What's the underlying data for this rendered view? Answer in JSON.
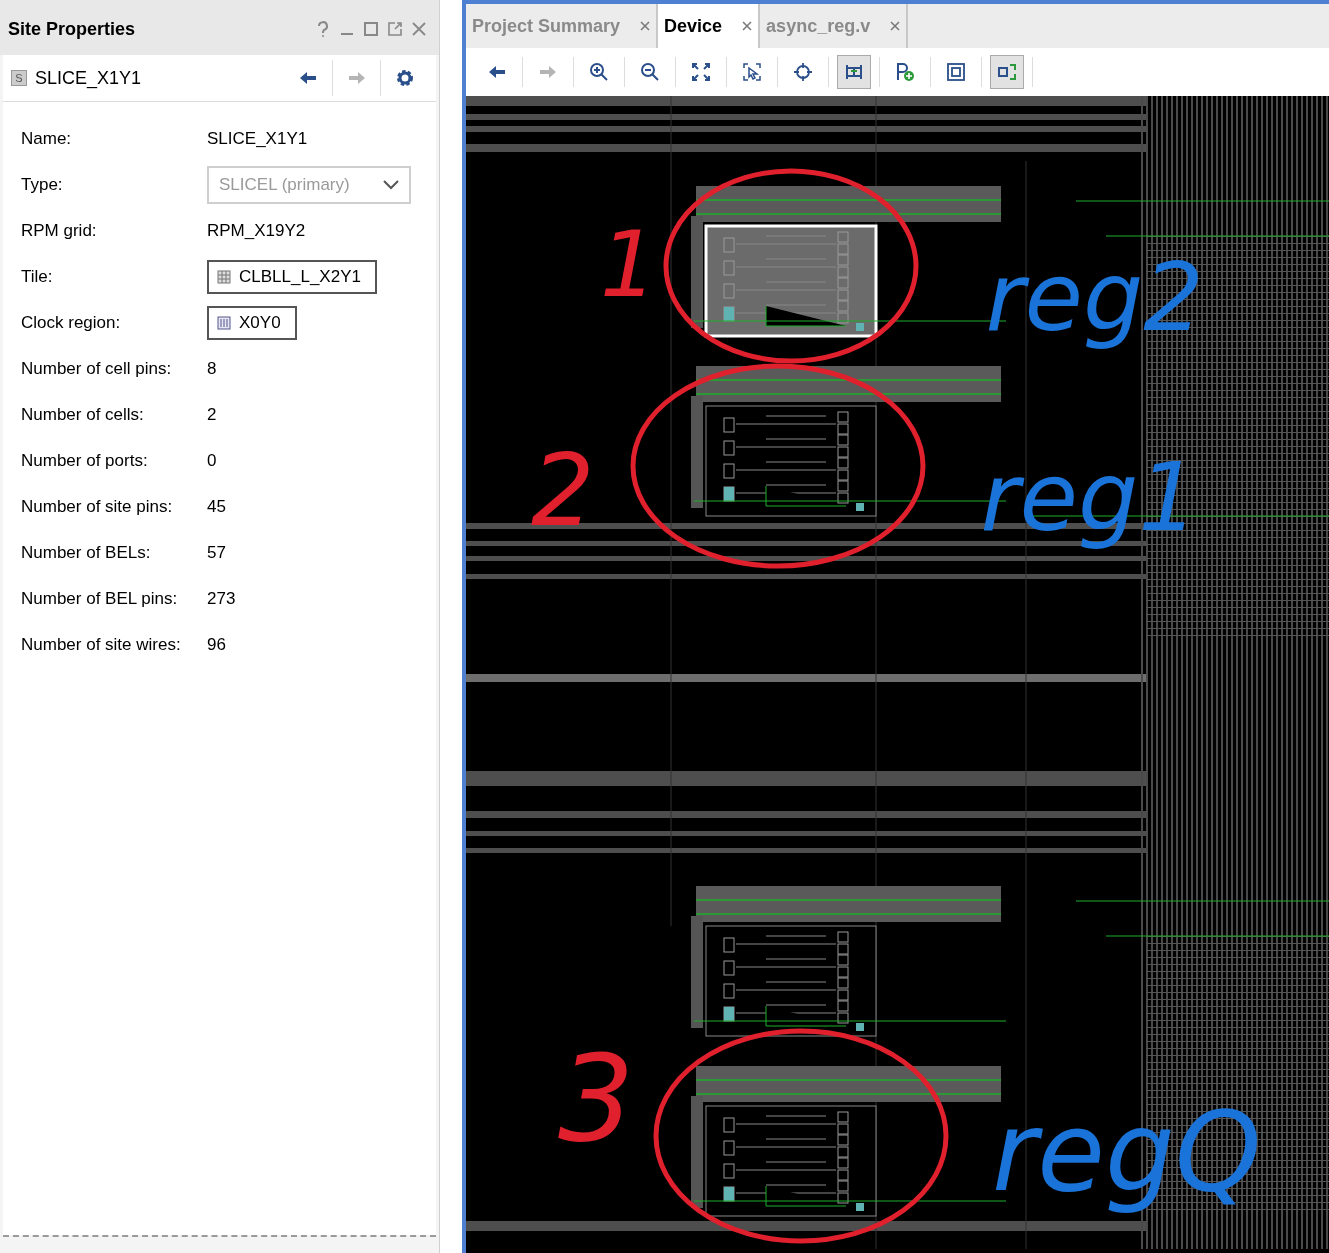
{
  "properties_panel": {
    "title": "Site Properties",
    "object": {
      "badge": "S",
      "name": "SLICE_X1Y1"
    },
    "nav": [
      {
        "kind": "back",
        "disabled": false
      },
      {
        "kind": "forward",
        "disabled": true
      },
      {
        "kind": "settings",
        "disabled": false
      }
    ],
    "rows": [
      {
        "label": "Name:",
        "kind": "text",
        "value": "SLICE_X1Y1"
      },
      {
        "label": "Type:",
        "kind": "dropdown",
        "value": "SLICEL (primary)",
        "disabled": true
      },
      {
        "label": "RPM grid:",
        "kind": "text",
        "value": "RPM_X19Y2"
      },
      {
        "label": "Tile:",
        "kind": "tile_link",
        "value": "CLBLL_L_X2Y1"
      },
      {
        "label": "Clock region:",
        "kind": "clock_link",
        "value": "X0Y0"
      },
      {
        "label": "Number of cell pins:",
        "kind": "text",
        "value": "8"
      },
      {
        "label": "Number of cells:",
        "kind": "text",
        "value": "2"
      },
      {
        "label": "Number of ports:",
        "kind": "text",
        "value": "0"
      },
      {
        "label": "Number of site pins:",
        "kind": "text",
        "value": "45"
      },
      {
        "label": "Number of BELs:",
        "kind": "text",
        "value": "57"
      },
      {
        "label": "Number of BEL pins:",
        "kind": "text",
        "value": "273"
      },
      {
        "label": "Number of site wires:",
        "kind": "text",
        "value": "96"
      }
    ]
  },
  "editor": {
    "tabs": [
      {
        "label": "Project Summary",
        "selected": false
      },
      {
        "label": "Device",
        "selected": true
      },
      {
        "label": "async_reg.v",
        "selected": false
      }
    ],
    "toolbar": [
      {
        "kind": "back",
        "disabled": false,
        "pressed": false
      },
      {
        "kind": "forward",
        "disabled": true,
        "pressed": false
      },
      {
        "kind": "zoom_in",
        "disabled": false,
        "pressed": false
      },
      {
        "kind": "zoom_out",
        "disabled": false,
        "pressed": false
      },
      {
        "kind": "fit",
        "disabled": false,
        "pressed": false
      },
      {
        "kind": "zoom_area",
        "disabled": false,
        "pressed": false
      },
      {
        "kind": "crosshair",
        "disabled": false,
        "pressed": false
      },
      {
        "kind": "routing",
        "disabled": false,
        "pressed": true
      },
      {
        "kind": "add_port",
        "disabled": false,
        "pressed": false
      },
      {
        "kind": "frame",
        "disabled": false,
        "pressed": false
      },
      {
        "kind": "expand",
        "disabled": false,
        "pressed": true
      }
    ],
    "device_view": {
      "slices": [
        {
          "selected": true
        },
        {
          "selected": false
        },
        {
          "selected": false
        },
        {
          "selected": false
        }
      ],
      "annotations": [
        {
          "text": "1",
          "color": "#e0202c"
        },
        {
          "text": "2",
          "color": "#e0202c"
        },
        {
          "text": "3",
          "color": "#e0202c"
        },
        {
          "text": "reg2",
          "color": "#1a73d8"
        },
        {
          "text": "reg1",
          "color": "#1a73d8"
        },
        {
          "text": "regQ",
          "color": "#1a73d8"
        }
      ]
    }
  }
}
